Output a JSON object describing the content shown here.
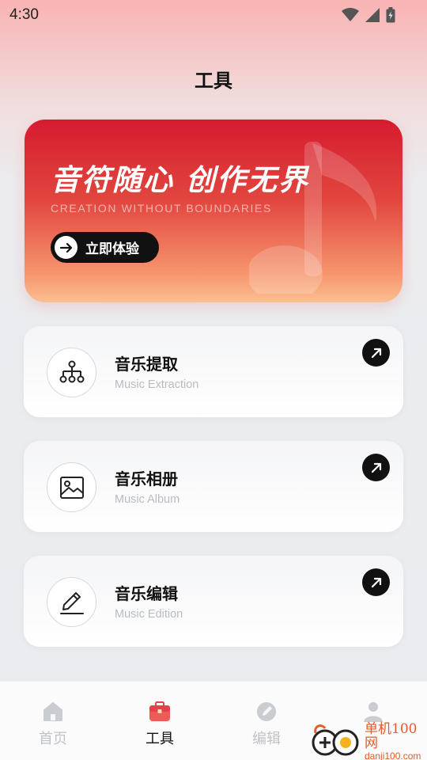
{
  "status": {
    "time": "4:30",
    "icons": [
      "wifi-icon",
      "cellular-signal-icon",
      "battery-charging-icon"
    ]
  },
  "header": {
    "title": "工具"
  },
  "banner": {
    "title": "音符随心 创作无界",
    "subtitle": "CREATION WITHOUT BOUNDARIES",
    "button_label": "立即体验",
    "icon": "music-note-icon",
    "colors": {
      "top": "#d61b2f",
      "bottom": "#fbbf90"
    }
  },
  "tools": [
    {
      "title": "音乐提取",
      "subtitle": "Music Extraction",
      "icon": "hierarchy-icon"
    },
    {
      "title": "音乐相册",
      "subtitle": "Music Album",
      "icon": "image-icon"
    },
    {
      "title": "音乐编辑",
      "subtitle": "Music Edition",
      "icon": "pencil-icon"
    }
  ],
  "nav": {
    "items": [
      {
        "label": "首页",
        "icon": "home-icon",
        "active": false
      },
      {
        "label": "工具",
        "icon": "toolbox-icon",
        "active": true
      },
      {
        "label": "编辑",
        "icon": "edit-icon",
        "active": false
      },
      {
        "label": "",
        "icon": "user-icon",
        "active": false
      }
    ],
    "active_color": "#e8404a"
  },
  "watermark": {
    "name": "单机100网",
    "url": "danji100.com"
  }
}
